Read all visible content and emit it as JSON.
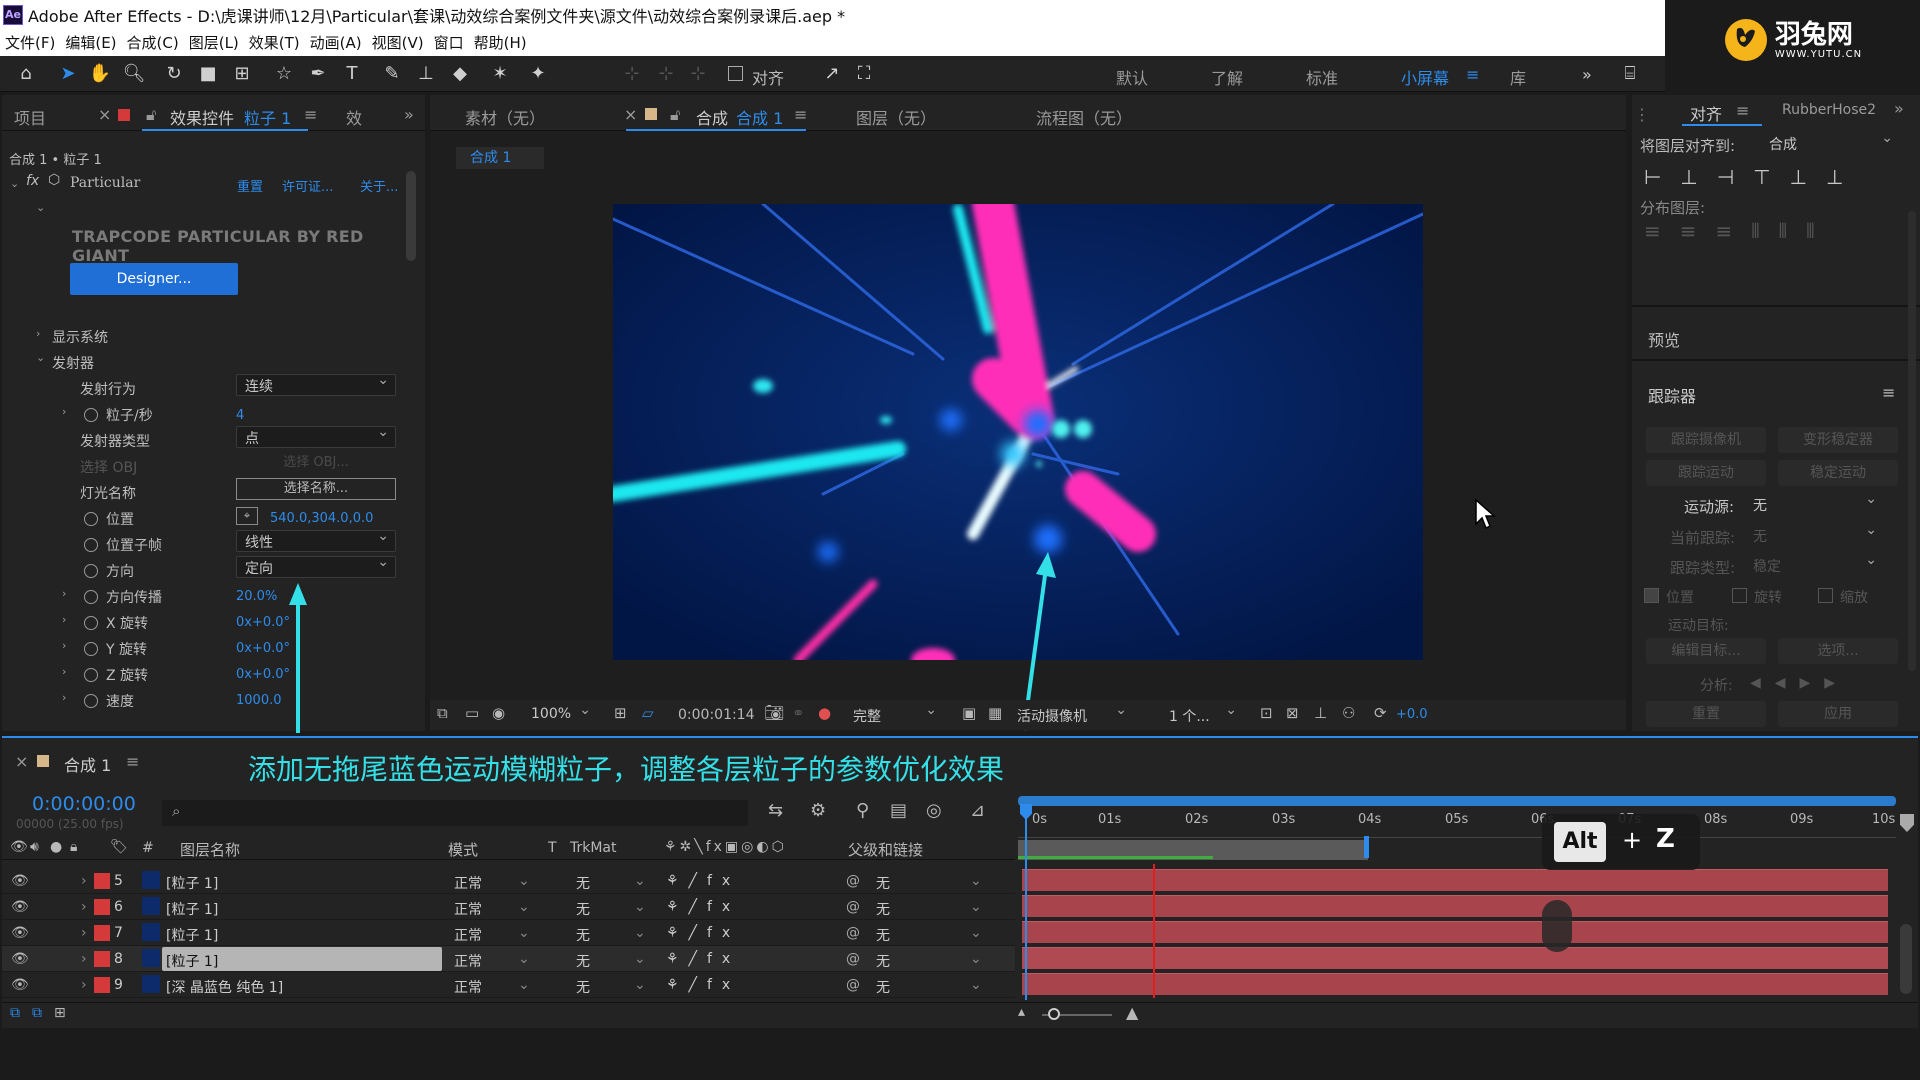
{
  "window": {
    "app_badge": "Ae",
    "title": "Adobe After Effects - D:\\虎课讲师\\12月\\Particular\\套课\\动效综合案例文件夹\\源文件\\动效综合案例录课后.aep *"
  },
  "menu": [
    "文件(F)",
    "编辑(E)",
    "合成(C)",
    "图层(L)",
    "效果(T)",
    "动画(A)",
    "视图(V)",
    "窗口",
    "帮助(H)"
  ],
  "logo": {
    "text": "羽兔网",
    "sub": "WWW.YUTU.CN"
  },
  "toolbar": {
    "snap_label": "对齐",
    "workspaces": [
      "默认",
      "了解",
      "标准",
      "小屏幕",
      "库"
    ],
    "active_workspace": "小屏幕"
  },
  "left_panel": {
    "tab_project": "项目",
    "tab_effects_prefix": "效果控件",
    "tab_effects_layer": "粒子 1",
    "tab_effects_short": "效",
    "breadcrumb": "合成 1 • 粒子 1",
    "effect_name": "Particular",
    "links": [
      "重置",
      "许可证...",
      "关于..."
    ],
    "banner": "TRAPCODE PARTICULAR BY RED GIANT",
    "designer_btn": "Designer...",
    "groups": {
      "display": "显示系统",
      "emitter": "发射器"
    },
    "props": [
      {
        "label": "发射行为",
        "value": "连续",
        "kind": "dropdown"
      },
      {
        "label": "粒子/秒",
        "value": "4",
        "kind": "value"
      },
      {
        "label": "发射器类型",
        "value": "点",
        "kind": "dropdown"
      },
      {
        "label": "选择 OBJ",
        "value": "选择 OBJ...",
        "kind": "disabled"
      },
      {
        "label": "灯光名称",
        "value": "选择名称...",
        "kind": "button"
      },
      {
        "label": "位置",
        "value": "540.0,304.0,0.0",
        "kind": "value"
      },
      {
        "label": "位置子帧",
        "value": "线性",
        "kind": "dropdown"
      },
      {
        "label": "方向",
        "value": "定向",
        "kind": "dropdown"
      },
      {
        "label": "方向传播",
        "value": "20.0%",
        "kind": "value"
      },
      {
        "label": "X 旋转",
        "value": "0x+0.0°",
        "kind": "value"
      },
      {
        "label": "Y 旋转",
        "value": "0x+0.0°",
        "kind": "value"
      },
      {
        "label": "Z 旋转",
        "value": "0x+0.0°",
        "kind": "value"
      },
      {
        "label": "速度",
        "value": "1000.0",
        "kind": "value"
      }
    ]
  },
  "center_panel": {
    "tab_footage": "素材（无）",
    "tab_comp_prefix": "合成",
    "tab_comp_name": "合成 1",
    "tab_layer": "图层（无）",
    "tab_flow": "流程图（无）",
    "comp_chip": "合成 1",
    "viewer_bar": {
      "zoom": "100%",
      "time": "0:00:01:14",
      "quality": "完整",
      "camera": "活动摄像机",
      "views": "1 个...",
      "exposure": "+0.0"
    }
  },
  "right_panel": {
    "tab_align": "对齐",
    "tab_rubber": "RubberHose2",
    "align_to_label": "将图层对齐到:",
    "align_to_value": "合成",
    "distribute_label": "分布图层:",
    "preview": "预览",
    "tracker": "跟踪器",
    "tracker_buttons": [
      "跟踪摄像机",
      "变形稳定器",
      "跟踪运动",
      "稳定运动"
    ],
    "motion_source_label": "运动源:",
    "motion_source_value": "无",
    "current_track_label": "当前跟踪:",
    "current_track_value": "无",
    "track_type_label": "跟踪类型:",
    "track_type_value": "稳定",
    "checks": [
      "位置",
      "旋转",
      "缩放"
    ],
    "motion_target": "运动目标:",
    "edit_target": "编辑目标...",
    "options": "选项...",
    "analyze": "分析:",
    "reset": "重置",
    "apply": "应用"
  },
  "timeline": {
    "comp_tab": "合成 1",
    "caption": "添加无拖尾蓝色运动模糊粒子，调整各层粒子的参数优化效果",
    "timecode": "0:00:00:00",
    "frame_info": "00000 (25.00 fps)",
    "col_num": "#",
    "col_name": "图层名称",
    "col_mode": "模式",
    "col_t": "T",
    "col_trkmat": "TrkMat",
    "col_parent": "父级和链接",
    "ruler": [
      "0s",
      "01s",
      "02s",
      "03s",
      "04s",
      "05s",
      "06s",
      "07s",
      "08s",
      "09s",
      "10s"
    ],
    "key_hint": {
      "alt": "Alt",
      "plus": "+",
      "z": "Z"
    },
    "layers": [
      {
        "num": "5",
        "name": "[粒子 1]",
        "mode": "正常",
        "trkmat": "无",
        "parent": "无"
      },
      {
        "num": "6",
        "name": "[粒子 1]",
        "mode": "正常",
        "trkmat": "无",
        "parent": "无"
      },
      {
        "num": "7",
        "name": "[粒子 1]",
        "mode": "正常",
        "trkmat": "无",
        "parent": "无"
      },
      {
        "num": "8",
        "name": "[粒子 1]",
        "mode": "正常",
        "trkmat": "无",
        "parent": "无"
      },
      {
        "num": "9",
        "name": "[深 晶蓝色 纯色 1]",
        "mode": "正常",
        "trkmat": "无",
        "parent": "无"
      }
    ]
  },
  "colors": {
    "accent": "#2d8ceb",
    "caption": "#33e0e8",
    "layer_label": "#d43a3a",
    "layer_bar": "#a7444c",
    "comp_bg": "#031a4e"
  }
}
